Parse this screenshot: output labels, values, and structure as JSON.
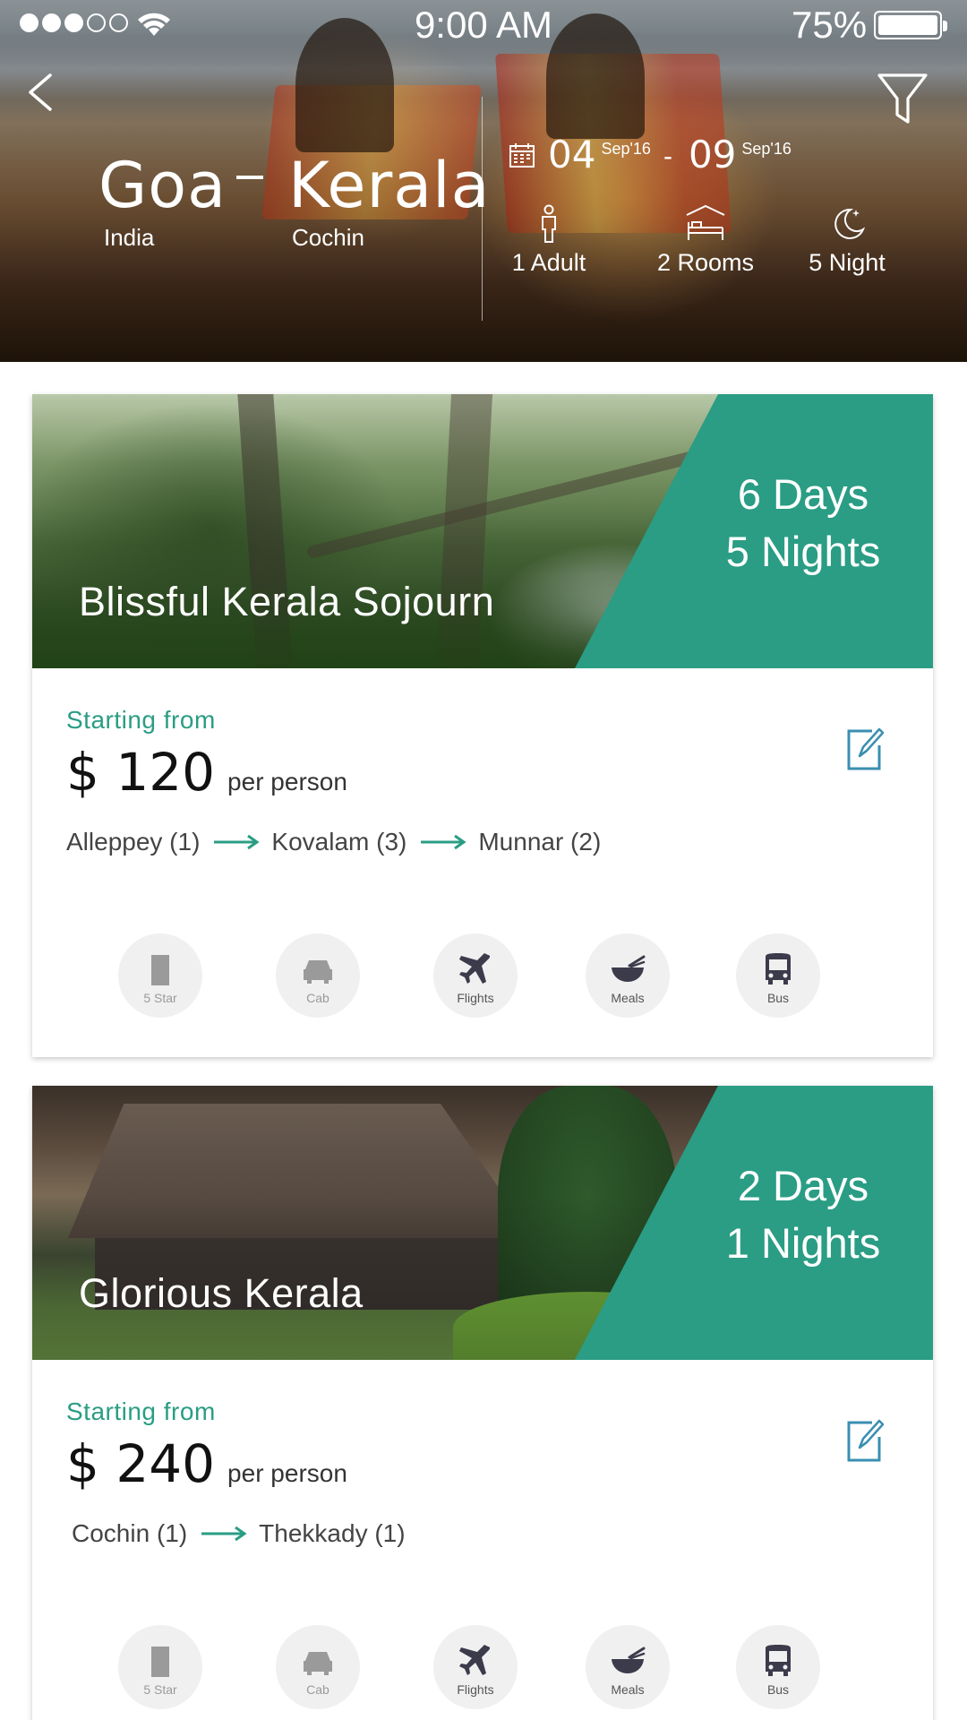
{
  "status_bar": {
    "time": "9:00 AM",
    "battery": "75%",
    "signal_bars_filled": 3,
    "signal_bars_total": 5
  },
  "search": {
    "from": {
      "city": "Goa",
      "country": "India"
    },
    "separator": "_",
    "to": {
      "city": "Kerala",
      "region": "Cochin"
    },
    "check_in": {
      "day": "04",
      "month": "Sep'16"
    },
    "date_separator": "-",
    "check_out": {
      "day": "09",
      "month": "Sep'16"
    },
    "guests": "1 Adult",
    "rooms": "2 Rooms",
    "nights": "5 Night"
  },
  "icons": {
    "back": "chevron-left-icon",
    "filter": "filter-funnel-icon",
    "calendar": "calendar-icon",
    "adult": "person-icon",
    "rooms": "bed-icon",
    "night": "moon-icon",
    "edit": "edit-icon",
    "arrow": "arrow-right-icon"
  },
  "colors": {
    "accent": "#2a9d84",
    "edit_icon": "#3a8fb0",
    "amenity_bg": "#f0f0f0",
    "amenity_active": "#4a4a5a",
    "amenity_inactive": "#9a9a9a"
  },
  "packages": [
    {
      "title": "Blissful Kerala Sojourn",
      "days": "6 Days",
      "nights": "5 Nights",
      "starting_label": "Starting  from",
      "price": "$ 120",
      "per": "per person",
      "route": [
        "Alleppey (1)",
        "Kovalam (3)",
        "Munnar (2)"
      ],
      "amenities": [
        {
          "label": "5 Star",
          "icon": "building-icon",
          "active": false
        },
        {
          "label": "Cab",
          "icon": "car-icon",
          "active": false
        },
        {
          "label": "Flights",
          "icon": "plane-icon",
          "active": true
        },
        {
          "label": "Meals",
          "icon": "bowl-icon",
          "active": true
        },
        {
          "label": "Bus",
          "icon": "bus-icon",
          "active": true
        }
      ]
    },
    {
      "title": "Glorious Kerala",
      "days": "2 Days",
      "nights": "1 Nights",
      "starting_label": "Starting  from",
      "price": "$ 240",
      "per": "per person",
      "route": [
        "Cochin (1)",
        "Thekkady (1)"
      ],
      "amenities": [
        {
          "label": "5 Star",
          "icon": "building-icon",
          "active": false
        },
        {
          "label": "Cab",
          "icon": "car-icon",
          "active": false
        },
        {
          "label": "Flights",
          "icon": "plane-icon",
          "active": true
        },
        {
          "label": "Meals",
          "icon": "bowl-icon",
          "active": true
        },
        {
          "label": "Bus",
          "icon": "bus-icon",
          "active": true
        }
      ]
    }
  ]
}
